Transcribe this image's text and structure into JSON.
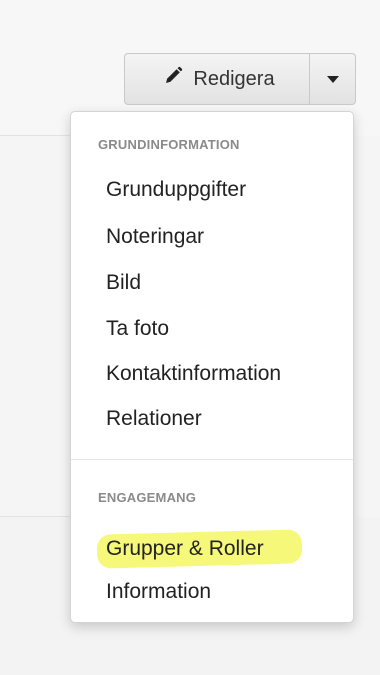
{
  "toolbar": {
    "edit_label": "Redigera",
    "edit_icon": "pencil-icon",
    "caret_icon": "caret-down-icon"
  },
  "menu": {
    "sections": [
      {
        "header": "GRUNDINFORMATION",
        "items": [
          "Grunduppgifter",
          "Noteringar",
          "Bild",
          "Ta foto",
          "Kontaktinformation",
          "Relationer"
        ]
      },
      {
        "header": "ENGAGEMANG",
        "items": [
          "Grupper & Roller",
          "Information"
        ]
      }
    ],
    "highlighted_item": "Grupper & Roller",
    "highlight_color": "#f6f87a"
  }
}
